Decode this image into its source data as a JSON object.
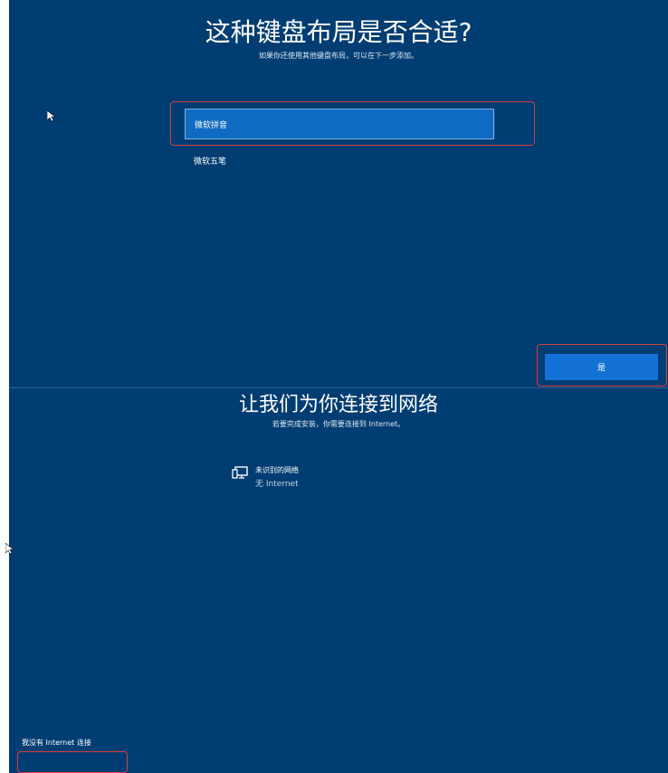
{
  "keyboard": {
    "title": "这种键盘布局是否合适?",
    "subtitle": "如果你还使用其他键盘布局，可以在下一步添加。",
    "options": [
      {
        "label": "微软拼音"
      },
      {
        "label": "微软五笔"
      }
    ],
    "selected": "微软拼音",
    "yes_button": "是"
  },
  "network": {
    "title": "让我们为你连接到网络",
    "subtitle": "若要完成安装，你需要连接到 Internet。",
    "item": {
      "name": "未识别的网络",
      "status": "无 Internet",
      "icon": "network-computer-icon"
    },
    "no_internet_link": "我没有 Internet 连接"
  },
  "colors": {
    "background": "#003d73",
    "selected": "#0f6bc2",
    "button": "#1472d6",
    "highlight_box": "#d9403a"
  }
}
